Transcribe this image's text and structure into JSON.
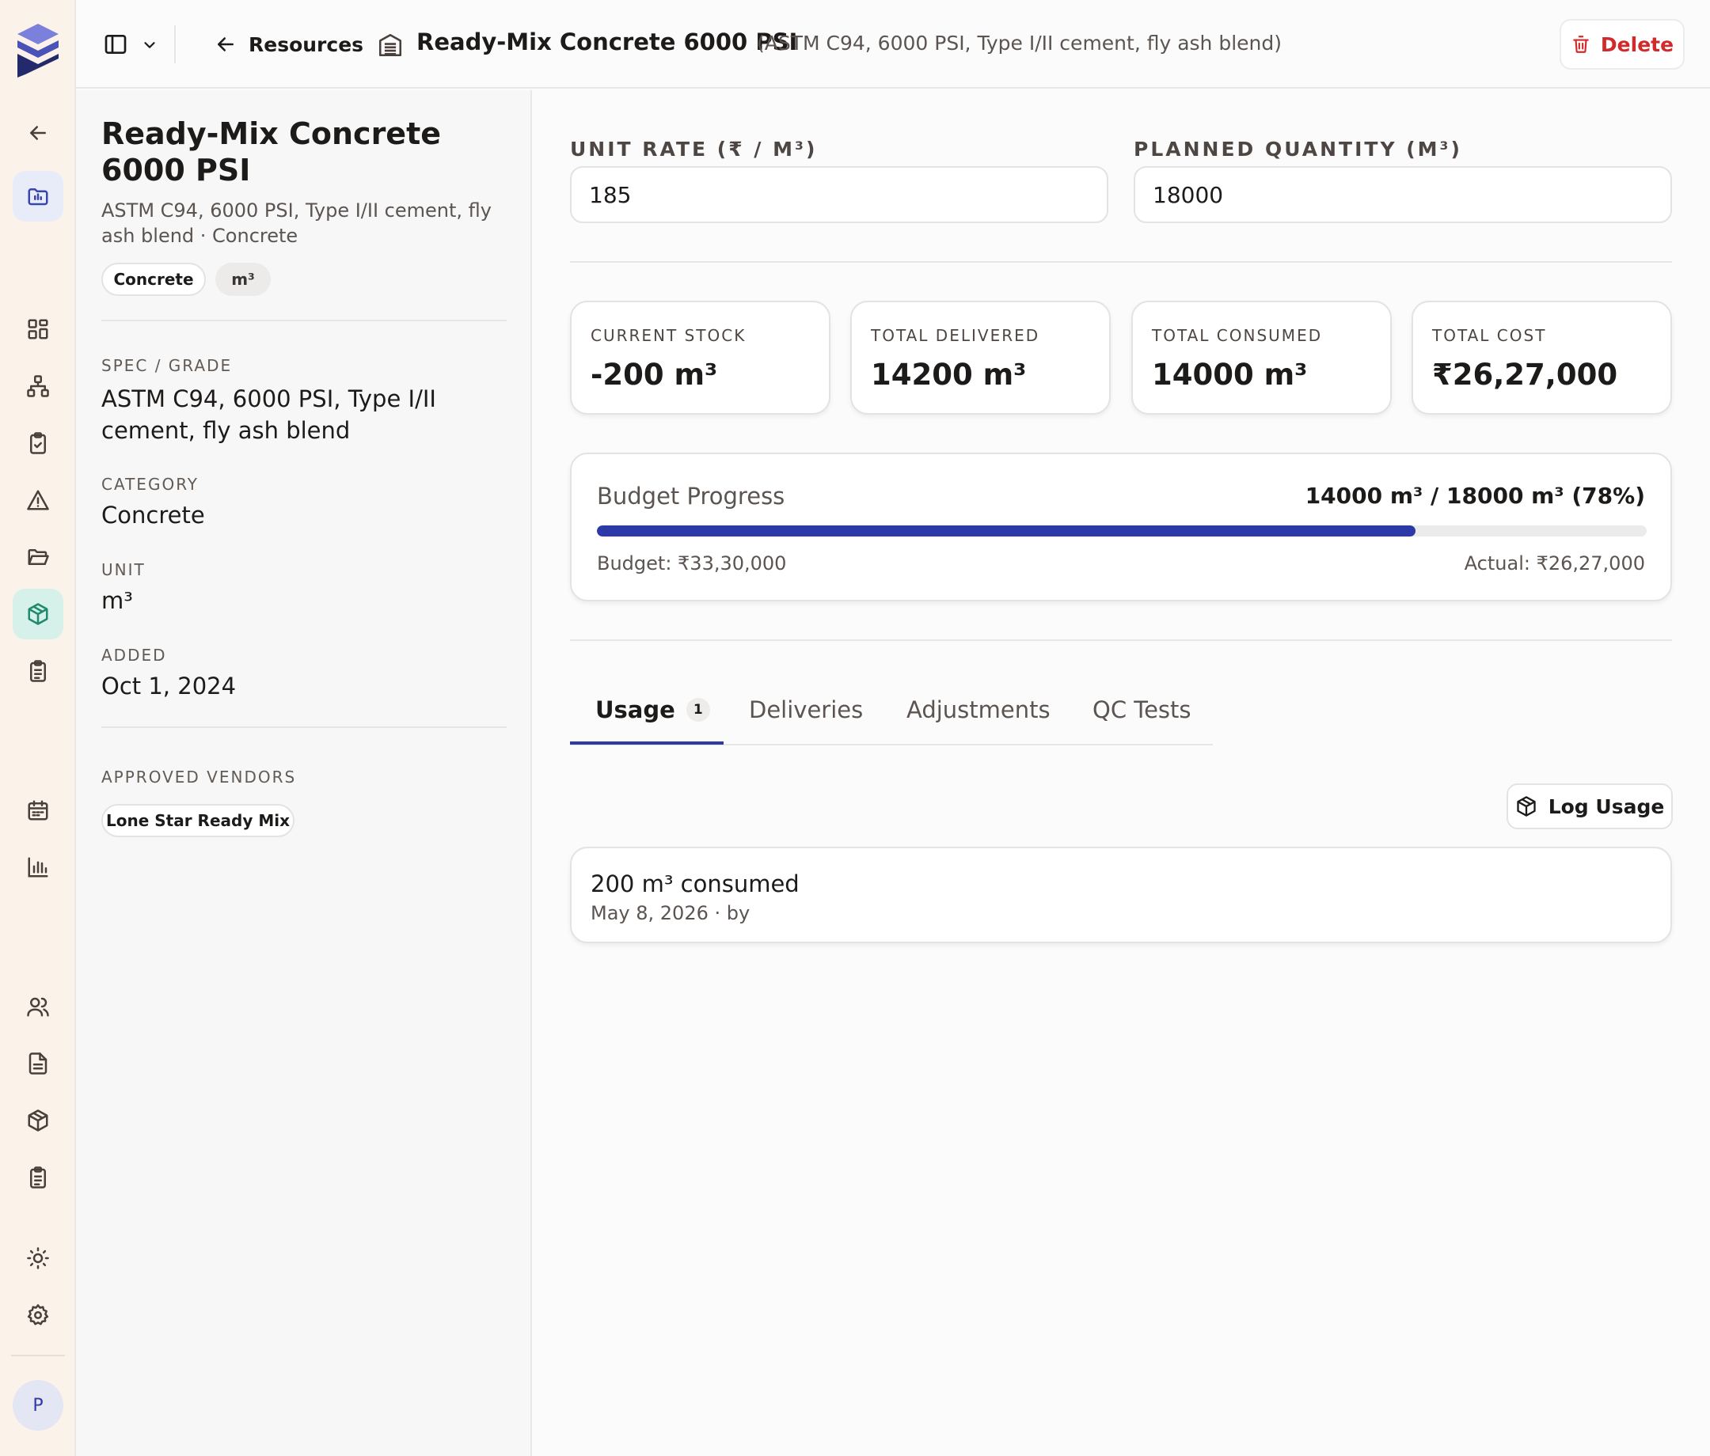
{
  "rail": {
    "colors": {
      "logo_top": "#6f75d6",
      "logo_mid": "#4951b5",
      "logo_dark": "#232a6b",
      "active_bg": "#e7ecf8",
      "inventory_active_bg": "#d6f0ea",
      "inventory_icon": "#1f8a6d",
      "avatar_bg": "#e5e6f3",
      "avatar_text": "#2f38a8"
    },
    "avatar_initial": "P"
  },
  "header": {
    "back_label": "Resources",
    "title": "Ready-Mix Concrete 6000 PSI",
    "subtitle": "(ASTM C94, 6000 PSI, Type I/II cement, fly ash blend)",
    "delete_label": "Delete"
  },
  "resource": {
    "name": "Ready-Mix Concrete 6000 PSI",
    "description": "ASTM C94, 6000 PSI, Type I/II cement, fly ash blend · Concrete",
    "tags": [
      "Concrete",
      "m³"
    ],
    "spec_label": "SPEC / GRADE",
    "spec_value": "ASTM C94, 6000 PSI, Type I/II cement, fly ash blend",
    "category_label": "CATEGORY",
    "category_value": "Concrete",
    "unit_label": "UNIT",
    "unit_value": "m³",
    "added_label": "ADDED",
    "added_value": "Oct 1, 2024",
    "vendors_label": "APPROVED VENDORS",
    "vendors": [
      "Lone Star Ready Mix"
    ]
  },
  "fields": {
    "unit_rate_label": "UNIT RATE (₹ / M³)",
    "unit_rate_value": "185",
    "planned_qty_label": "PLANNED QUANTITY (M³)",
    "planned_qty_value": "18000"
  },
  "stats": [
    {
      "label": "CURRENT STOCK",
      "value": "-200 m³"
    },
    {
      "label": "TOTAL DELIVERED",
      "value": "14200 m³"
    },
    {
      "label": "TOTAL CONSUMED",
      "value": "14000 m³"
    },
    {
      "label": "TOTAL COST",
      "value": "₹26,27,000"
    }
  ],
  "budget": {
    "title": "Budget Progress",
    "summary": "14000 m³ / 18000 m³ (78%)",
    "progress": 0.78,
    "bar_color": "#2c3aa8",
    "budget_text": "Budget: ₹33,30,000",
    "actual_text": "Actual: ₹26,27,000"
  },
  "tabs": [
    {
      "label": "Usage",
      "badge": "1"
    },
    {
      "label": "Deliveries"
    },
    {
      "label": "Adjustments"
    },
    {
      "label": "QC Tests"
    }
  ],
  "log_usage_label": "Log Usage",
  "usage_entries": [
    {
      "title": "200 m³ consumed",
      "meta": "May 8, 2026 · by"
    }
  ]
}
